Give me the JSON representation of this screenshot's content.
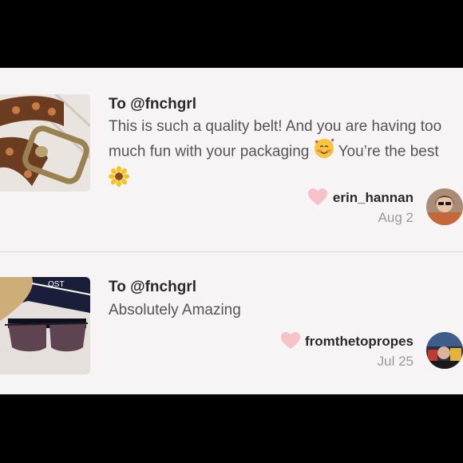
{
  "reviews": [
    {
      "to": "To @fnchgrl",
      "message_parts": [
        "This is such a quality belt! And you are having too much fun with your packaging ",
        " You’re the best "
      ],
      "emojis": [
        "smiling-face-with-hearts-icon",
        "sunflower-icon"
      ],
      "username": "erin_hannan",
      "date": "Aug 2",
      "thumb_icon": "leather-belt-photo",
      "avatar_icon": "user-avatar-photo"
    },
    {
      "to": "To @fnchgrl",
      "message": "Absolutely Amazing",
      "username": "fromthetopropes",
      "date": "Jul 25",
      "thumb_icon": "sunglasses-photo",
      "avatar_icon": "user-avatar-photo"
    }
  ],
  "colors": {
    "heart": "#f6c1c8",
    "text_dark": "#2a2a2a",
    "text_mid": "#555555",
    "text_light": "#9a9a9a",
    "panel_bg": "#f6f4f5"
  }
}
